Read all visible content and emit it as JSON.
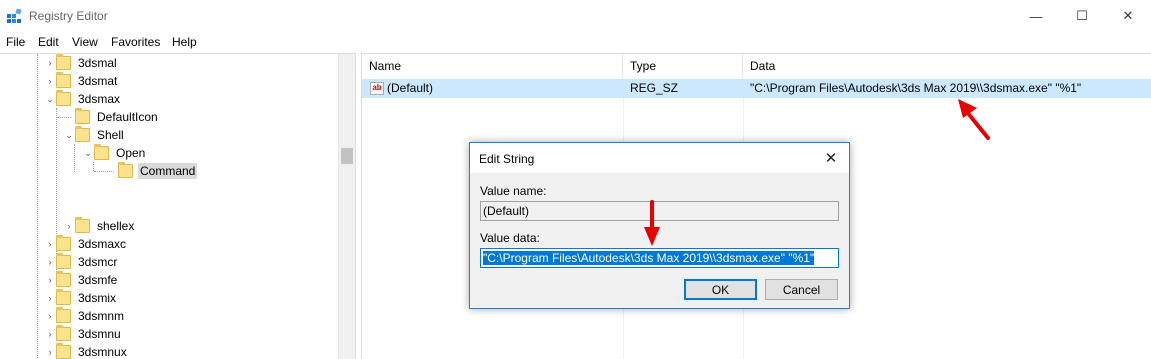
{
  "window": {
    "title": "Registry Editor",
    "controls": [
      "—",
      "☐",
      "✕"
    ]
  },
  "menu": [
    "File",
    "Edit",
    "View",
    "Favorites",
    "Help"
  ],
  "tree": {
    "items": [
      {
        "label": "3dsmal",
        "expander": "›"
      },
      {
        "label": "3dsmat",
        "expander": "›"
      },
      {
        "label": "3dsmax",
        "expander": "⌄"
      },
      {
        "label": "DefaultIcon",
        "expander": ""
      },
      {
        "label": "Shell",
        "expander": "⌄"
      },
      {
        "label": "Open",
        "expander": "⌄"
      },
      {
        "label": "Command",
        "expander": ""
      },
      {
        "label": "shellex",
        "expander": "›"
      },
      {
        "label": "3dsmaxc",
        "expander": "›"
      },
      {
        "label": "3dsmcr",
        "expander": "›"
      },
      {
        "label": "3dsmfe",
        "expander": "›"
      },
      {
        "label": "3dsmix",
        "expander": "›"
      },
      {
        "label": "3dsmnm",
        "expander": "›"
      },
      {
        "label": "3dsmnu",
        "expander": "›"
      },
      {
        "label": "3dsmnux",
        "expander": "›"
      }
    ]
  },
  "list": {
    "headers": {
      "name": "Name",
      "type": "Type",
      "data": "Data"
    },
    "rows": [
      {
        "icon": "ab",
        "name": "(Default)",
        "type": "REG_SZ",
        "data": "\"C:\\Program Files\\Autodesk\\3ds Max 2019\\\\3dsmax.exe\" \"%1\""
      }
    ]
  },
  "dialog": {
    "title": "Edit String",
    "close": "✕",
    "value_name_label": "Value name:",
    "value_name": "(Default)",
    "value_data_label": "Value data:",
    "value_data": "\"C:\\Program Files\\Autodesk\\3ds Max 2019\\\\3dsmax.exe\" \"%1\"",
    "ok_label": "OK",
    "cancel_label": "Cancel"
  },
  "colors": {
    "selection": "#cce8ff",
    "accent": "#0078d7",
    "annotation_arrow": "#e60000"
  }
}
